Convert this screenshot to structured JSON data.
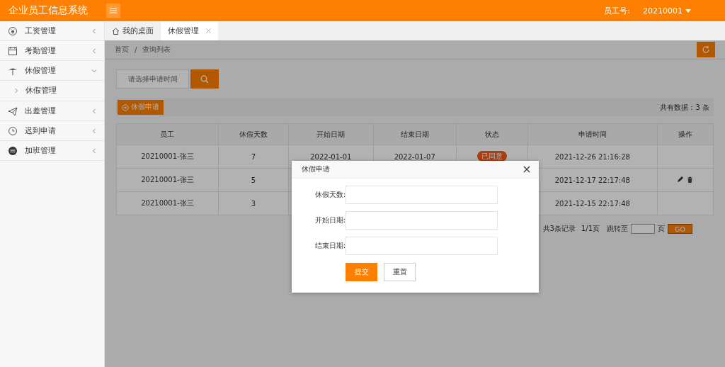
{
  "header": {
    "title": "企业员工信息系统",
    "user_label": "员工号:",
    "user_id": "20210001"
  },
  "sidebar": {
    "items": [
      {
        "label": "工资管理",
        "expanded": false
      },
      {
        "label": "考勤管理",
        "expanded": false
      },
      {
        "label": "休假管理",
        "expanded": true,
        "children": [
          {
            "label": "休假管理"
          }
        ]
      },
      {
        "label": "出差管理",
        "expanded": false
      },
      {
        "label": "迟到申请",
        "expanded": false
      },
      {
        "label": "加班管理",
        "expanded": false
      }
    ]
  },
  "tabs": [
    {
      "label": "我的桌面",
      "selected": false
    },
    {
      "label": "休假管理",
      "selected": true
    }
  ],
  "breadcrumb": [
    "首页",
    "/",
    "查询列表"
  ],
  "search": {
    "placeholder": "请选择申请时间"
  },
  "toolbar": {
    "add_button": "休假申请",
    "total": "共有数据：3 条"
  },
  "table": {
    "columns": [
      "员工",
      "休假天数",
      "开始日期",
      "结束日期",
      "状态",
      "申请时间",
      "操作"
    ],
    "rows": [
      {
        "employee": "20210001-张三",
        "days": "7",
        "start_date": "2022-01-01",
        "end_date": "2022-01-07",
        "status": "已同意",
        "applied_at": "2021-12-26 21:16:28",
        "actions_shown": false
      },
      {
        "employee": "20210001-张三",
        "days": "5",
        "applied_at": "2021-12-17 22:17:48",
        "actions_shown": true
      },
      {
        "employee": "20210001-张三",
        "days": "3",
        "applied_at": "2021-12-15 22:17:48",
        "actions_shown": false
      }
    ]
  },
  "pagination": {
    "records": "共3条记录",
    "pages": "1/1页",
    "jump_label": "跳转至",
    "page_unit": "页",
    "go": "GO"
  },
  "dialog": {
    "title": "休假申请",
    "fields": [
      {
        "label": "休假天数:"
      },
      {
        "label": "开始日期:"
      },
      {
        "label": "结束日期:"
      }
    ],
    "submit": "提交",
    "reset": "重置"
  }
}
